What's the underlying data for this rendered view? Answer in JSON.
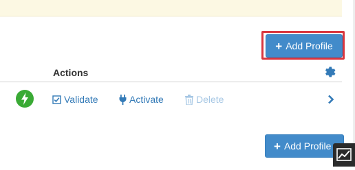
{
  "toolbar": {
    "add_profile_label": "Add Profile",
    "add_icon": "plus-icon"
  },
  "table": {
    "header": {
      "actions_label": "Actions",
      "settings_icon": "gear-icon"
    },
    "rows": [
      {
        "status_icon": "bolt-icon",
        "validate_label": "Validate",
        "activate_label": "Activate",
        "delete_label": "Delete",
        "expand_icon": "chevron-right-icon"
      }
    ]
  },
  "footer": {
    "add_profile_label": "Add Profile",
    "chart_icon": "trend-chart-icon"
  },
  "colors": {
    "primary": "#428bca",
    "link": "#337ab7",
    "disabled_link": "#a6c7e4",
    "status_green": "#3aaa35",
    "notice_bg": "#fcf8e3",
    "focus_outline": "#d9363e"
  }
}
